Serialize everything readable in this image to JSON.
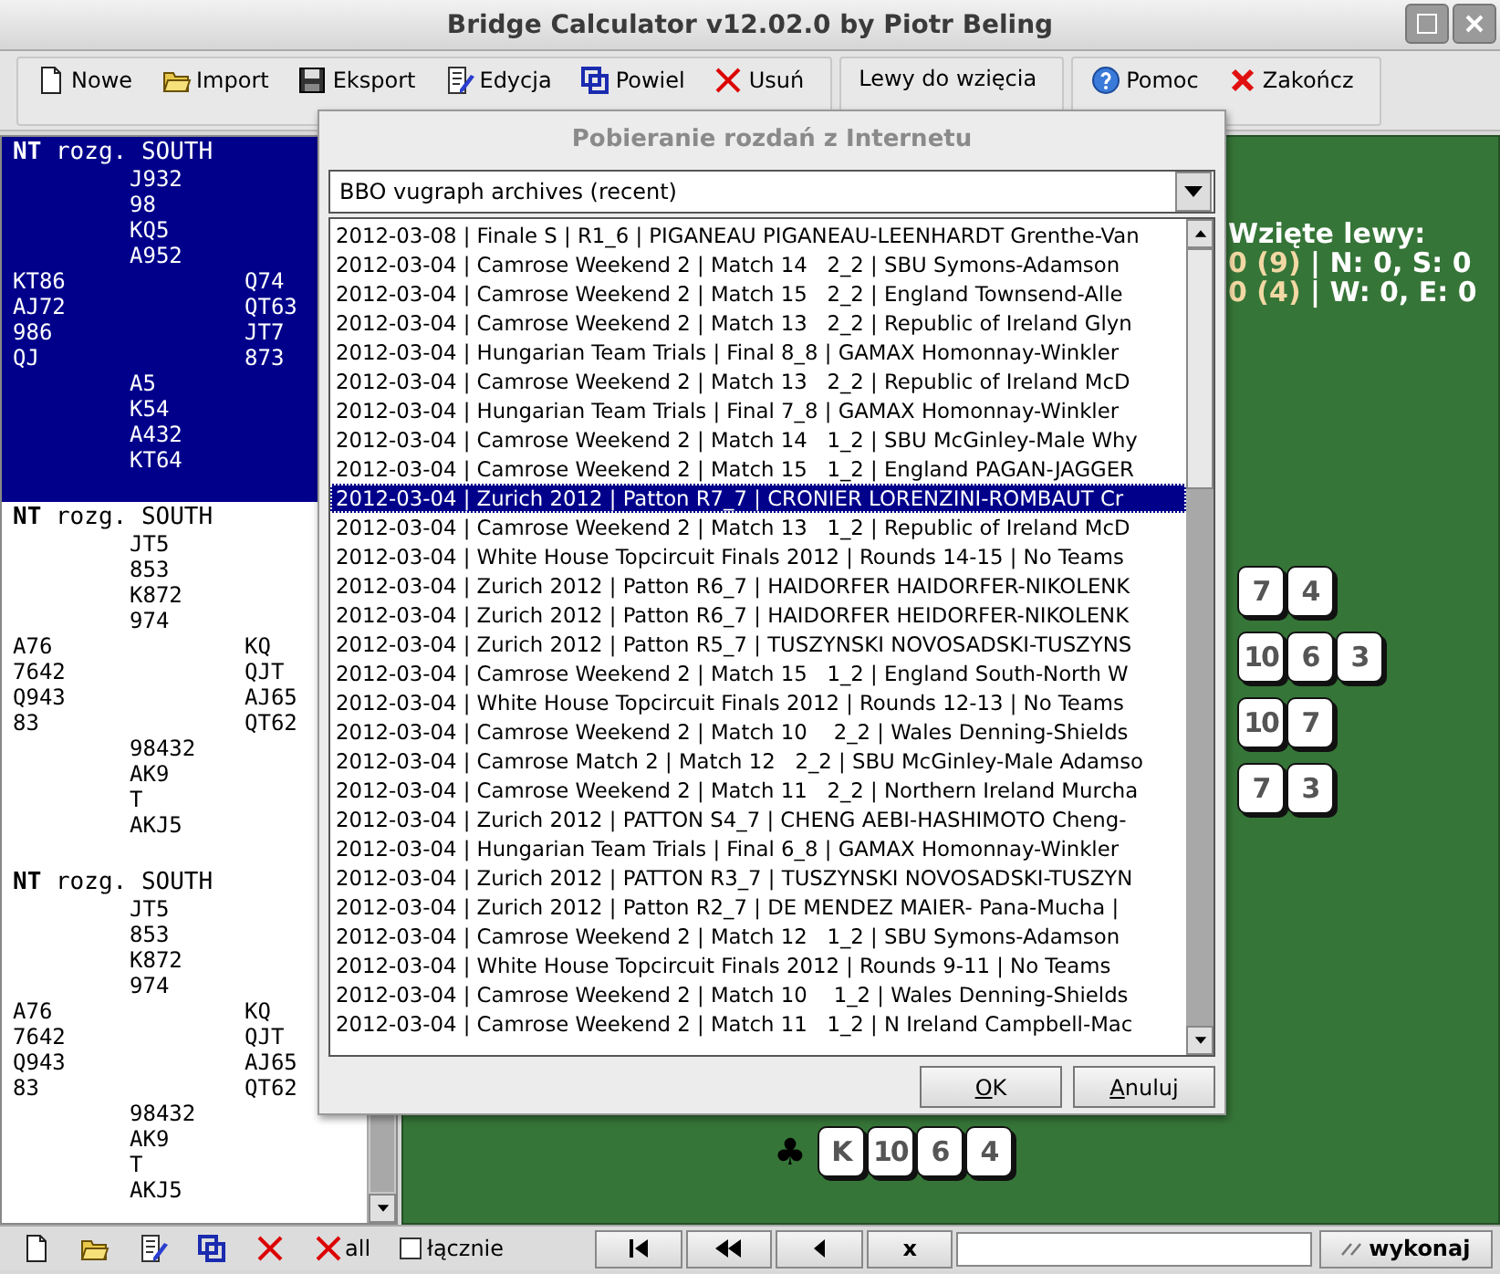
{
  "window": {
    "title": "Bridge Calculator v12.02.0 by Piotr Beling"
  },
  "toolbar": {
    "groups": [
      {
        "buttons": [
          {
            "kind": "new",
            "label": "Nowe"
          },
          {
            "kind": "open",
            "label": "Import"
          },
          {
            "kind": "save",
            "label": "Eksport"
          },
          {
            "kind": "edit",
            "label": "Edycja"
          },
          {
            "kind": "copy",
            "label": "Powiel"
          },
          {
            "kind": "delete",
            "label": "Usuń"
          }
        ]
      },
      {
        "buttons": [
          {
            "kind": "plain",
            "label": "Lewy do wzięcia"
          }
        ]
      },
      {
        "buttons": [
          {
            "kind": "help",
            "label": "Pomoc"
          },
          {
            "kind": "quit",
            "label": "Zakończ"
          }
        ]
      }
    ]
  },
  "deals": [
    {
      "header": "**NT** rozg. SOUTH",
      "selected": true,
      "north": [
        "J932",
        "98",
        "KQ5",
        "A952"
      ],
      "west": [
        "KT86",
        "AJ72",
        "986",
        "QJ"
      ],
      "east": [
        "Q74",
        "QT63",
        "JT7",
        "873"
      ],
      "south": [
        "A5",
        "K54",
        "A432",
        "KT64"
      ]
    },
    {
      "header": "**NT** rozg. SOUTH",
      "selected": false,
      "north": [
        "JT5",
        "853",
        "K872",
        "974"
      ],
      "west": [
        "A76",
        "7642",
        "Q943",
        "83"
      ],
      "east": [
        "KQ",
        "QJT",
        "AJ65",
        "QT62"
      ],
      "south": [
        "98432",
        "AK9",
        "T",
        "AKJ5"
      ]
    },
    {
      "header": "**NT** rozg. SOUTH",
      "selected": false,
      "north": [
        "JT5",
        "853",
        "K872",
        "974"
      ],
      "west": [
        "A76",
        "7642",
        "Q943",
        "83"
      ],
      "east": [
        "KQ",
        "QJT",
        "AJ65",
        "QT62"
      ],
      "south": [
        "98432",
        "AK9",
        "T",
        "AKJ5"
      ]
    }
  ],
  "table": {
    "tricks_title": "Wzięte lewy:",
    "tricks": [
      {
        "count": "0 (9)",
        "detail": "| N: 0, S: 0"
      },
      {
        "count": "0 (4)",
        "detail": "| W: 0, E: 0"
      }
    ],
    "east_hand": [
      {
        "cards": [
          "7",
          "4"
        ]
      },
      {
        "cards": [
          "10",
          "6",
          "3"
        ]
      },
      {
        "cards": [
          "10",
          "7"
        ]
      },
      {
        "cards": [
          "7",
          "3"
        ]
      }
    ],
    "south_hand": {
      "suit": "♣",
      "cards": [
        "K",
        "10",
        "6",
        "4"
      ]
    }
  },
  "dialog": {
    "title": "Pobieranie rozdań z Internetu",
    "source": "BBO vugraph archives (recent)",
    "items": [
      {
        "text": "2012-03-08 | Finale S | R1_6 | PIGANEAU PIGANEAU-LEENHARDT Grenthe-Van",
        "selected": false
      },
      {
        "text": "2012-03-04 | Camrose Weekend 2 | Match 14   2_2 | SBU Symons-Adamson",
        "selected": false
      },
      {
        "text": "2012-03-04 | Camrose Weekend 2 | Match 15   2_2 | England Townsend-Alle",
        "selected": false
      },
      {
        "text": "2012-03-04 | Camrose Weekend 2 | Match 13   2_2 | Republic of Ireland Glyn",
        "selected": false
      },
      {
        "text": "2012-03-04 | Hungarian Team Trials | Final 8_8 | GAMAX Homonnay-Winkler",
        "selected": false
      },
      {
        "text": "2012-03-04 | Camrose Weekend 2 | Match 13   2_2 | Republic of Ireland McD",
        "selected": false
      },
      {
        "text": "2012-03-04 | Hungarian Team Trials | Final 7_8 | GAMAX Homonnay-Winkler",
        "selected": false
      },
      {
        "text": "2012-03-04 | Camrose Weekend 2 | Match 14   1_2 | SBU McGinley-Male Why",
        "selected": false
      },
      {
        "text": "2012-03-04 | Camrose Weekend 2 | Match 15   1_2 | England PAGAN-JAGGER",
        "selected": false
      },
      {
        "text": "2012-03-04 | Zurich 2012 | Patton R7_7 | CRONIER LORENZINI-ROMBAUT Cr",
        "selected": true
      },
      {
        "text": "2012-03-04 | Camrose Weekend 2 | Match 13   1_2 | Republic of Ireland McD",
        "selected": false
      },
      {
        "text": "2012-03-04 | White House Topcircuit Finals 2012 | Rounds 14-15 | No Teams",
        "selected": false
      },
      {
        "text": "2012-03-04 | Zurich 2012 | Patton R6_7 | HAIDORFER HAIDORFER-NIKOLENK",
        "selected": false
      },
      {
        "text": "2012-03-04 | Zurich 2012 | Patton R6_7 | HAIDORFER HEIDORFER-NIKOLENK",
        "selected": false
      },
      {
        "text": "2012-03-04 | Zurich 2012 | Patton R5_7 | TUSZYNSKI NOVOSADSKI-TUSZYNS",
        "selected": false
      },
      {
        "text": "2012-03-04 | Camrose Weekend 2 | Match 15   1_2 | England South-North W",
        "selected": false
      },
      {
        "text": "2012-03-04 | White House Topcircuit Finals 2012 | Rounds 12-13 | No Teams",
        "selected": false
      },
      {
        "text": "2012-03-04 | Camrose Weekend 2 | Match 10    2_2 | Wales Denning-Shields",
        "selected": false
      },
      {
        "text": "2012-03-04 | Camrose Match 2 | Match 12   2_2 | SBU McGinley-Male Adamso",
        "selected": false
      },
      {
        "text": "2012-03-04 | Camrose Weekend 2 | Match 11   2_2 | Northern Ireland Murcha",
        "selected": false
      },
      {
        "text": "2012-03-04 | Zurich 2012 | PATTON S4_7 | CHENG AEBI-HASHIMOTO Cheng-",
        "selected": false
      },
      {
        "text": "2012-03-04 | Hungarian Team Trials | Final 6_8 | GAMAX Homonnay-Winkler",
        "selected": false
      },
      {
        "text": "2012-03-04 | Zurich 2012 | PATTON R3_7 | TUSZYNSKI NOVOSADSKI-TUSZYN",
        "selected": false
      },
      {
        "text": "2012-03-04 | Zurich 2012 | Patton R2_7 | DE MENDEZ MAIER- Pana-Mucha |",
        "selected": false
      },
      {
        "text": "2012-03-04 | Camrose Weekend 2 | Match 12   1_2 | SBU Symons-Adamson",
        "selected": false
      },
      {
        "text": "2012-03-04 | White House Topcircuit Finals 2012 | Rounds 9-11 | No Teams",
        "selected": false
      },
      {
        "text": "2012-03-04 | Camrose Weekend 2 | Match 10    1_2 | Wales Denning-Shields",
        "selected": false
      },
      {
        "text": "2012-03-04 | Camrose Weekend 2 | Match 11   1_2 | N Ireland Campbell-Mac",
        "selected": false
      }
    ],
    "buttons": [
      "OK",
      "Anuluj"
    ]
  },
  "bottom_bar": {
    "tools": [
      {
        "kind": "new"
      },
      {
        "kind": "open"
      },
      {
        "kind": "edit"
      },
      {
        "kind": "copy"
      },
      {
        "kind": "delete"
      }
    ],
    "delete_all": {
      "label": "all"
    },
    "checkbox": {
      "label": "łącznie",
      "checked": false
    },
    "nav": [
      {
        "kind": "first"
      },
      {
        "kind": "rewind"
      },
      {
        "kind": "back"
      },
      {
        "kind": "text",
        "label": "x"
      }
    ],
    "run_button": {
      "label": "wykonaj"
    }
  }
}
